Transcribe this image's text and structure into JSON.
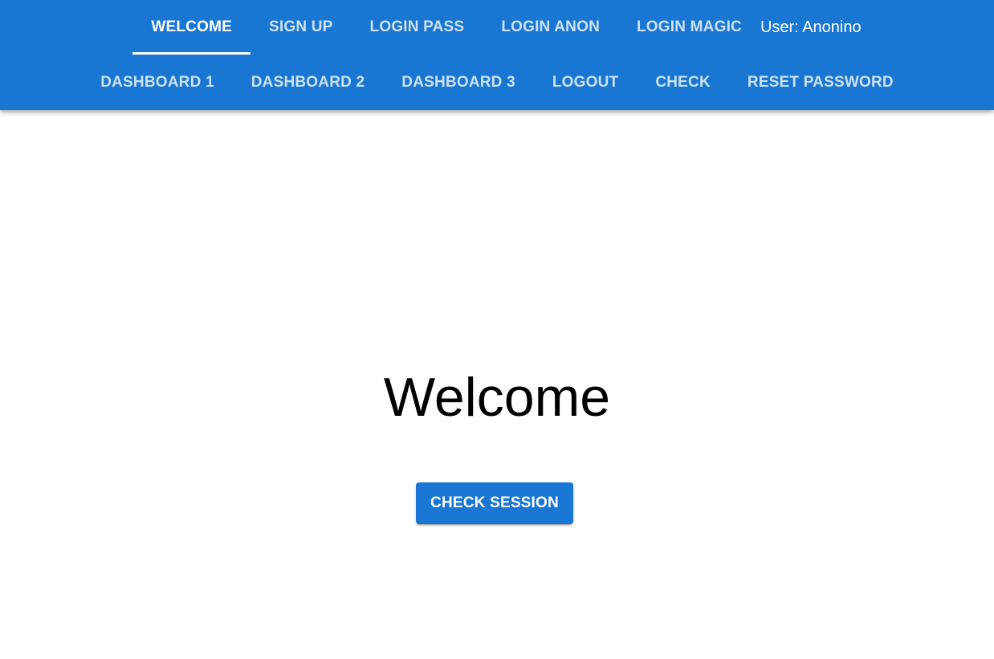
{
  "nav": {
    "row1": [
      {
        "label": "WELCOME",
        "active": true
      },
      {
        "label": "SIGN UP",
        "active": false
      },
      {
        "label": "LOGIN PASS",
        "active": false
      },
      {
        "label": "LOGIN ANON",
        "active": false
      },
      {
        "label": "LOGIN MAGIC",
        "active": false
      }
    ],
    "user_label": "User: Anonino",
    "row2": [
      {
        "label": "DASHBOARD 1"
      },
      {
        "label": "DASHBOARD 2"
      },
      {
        "label": "DASHBOARD 3"
      },
      {
        "label": "LOGOUT"
      },
      {
        "label": "CHECK"
      },
      {
        "label": "RESET PASSWORD"
      }
    ]
  },
  "main": {
    "title": "Welcome",
    "check_session_label": "CHECK SESSION"
  },
  "colors": {
    "primary": "#1976d2",
    "on_primary": "#ffffff",
    "background": "#ffffff",
    "text": "#000000"
  }
}
